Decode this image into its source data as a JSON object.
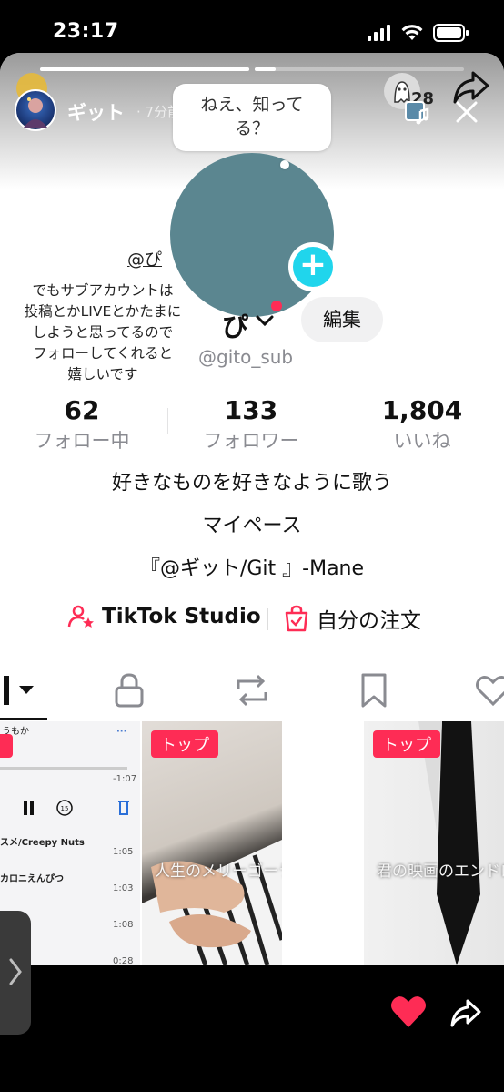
{
  "status": {
    "time": "23:17"
  },
  "story": {
    "author_name": "ギット",
    "author_time": "· 7分前",
    "bubble_text_1": "ねえ、知って",
    "bubble_text_2": "る？",
    "progress": [
      1.0,
      0.0
    ],
    "viewer_count": "28"
  },
  "note": {
    "handle": "@ぴ",
    "lines": [
      "でもサブアカウントは",
      "投稿とかLIVEとかたまに",
      "しようと思ってるので",
      "フォローしてくれると",
      "嬉しいです"
    ]
  },
  "profile": {
    "name": "ぴ",
    "edit_label": "編集",
    "handle": "@gito_sub"
  },
  "stats": [
    {
      "value": "62",
      "label": "フォロー中"
    },
    {
      "value": "133",
      "label": "フォロワー"
    },
    {
      "value": "1,804",
      "label": "いいね"
    }
  ],
  "bio": [
    "好きなものを好きなように歌う",
    "マイペース",
    "『@ギット/Git 』-Mane"
  ],
  "links": {
    "studio": "TikTok Studio",
    "orders": "自分の注文"
  },
  "grid": {
    "playlist": {
      "header": "うもか",
      "time": "-1:07",
      "rows": [
        {
          "title": "スメ/Creepy Nuts",
          "dur": "1:05"
        },
        {
          "title": "カロニえんぴつ",
          "dur": "1:03"
        },
        {
          "title": "",
          "dur": "1:08"
        },
        {
          "title": "",
          "dur": "0:28"
        }
      ]
    },
    "videos": [
      {
        "badge": "トップ",
        "caption": "人生のメリーゴーランド"
      },
      {
        "badge": "トップ",
        "caption": "君の映画のエンドロ"
      }
    ]
  },
  "colors": {
    "accent": "#fe2c55",
    "follow": "#20d5ec"
  }
}
